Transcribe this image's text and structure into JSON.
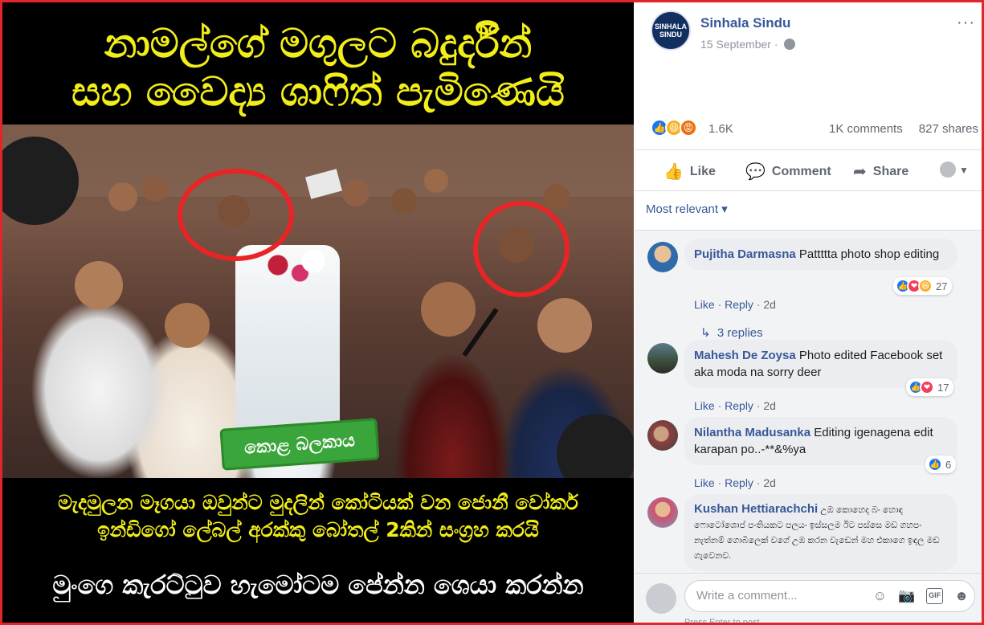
{
  "image": {
    "headline_1": "නාමල්ගේ මගුලට බදුර්දීන්",
    "headline_2": "සහ වෛද්‍ය ශාෆිත් පැමිණෙයි",
    "banner_text": "කොළ බලකාය",
    "bottom_1": "මැදමුලන මෑගයා ඔවුන්ට මුදලින් කෝටියක් වන ජොනී වෝකර්",
    "bottom_2": "ඉන්ඩිගෝ ලේබල් අරක්කු බෝතල් 2කින් සංග්‍රහ කරයි",
    "bottom_3": "මුංගෙ කැරට්ටුව හැමෝටම පේන්න ශෙයා කරන්න"
  },
  "post": {
    "page_name": "Sinhala Sindu",
    "avatar_text": "SINHALA SINDU",
    "date": "15 September · ",
    "more": "···",
    "reactions_count": "1.6K",
    "comments_count": "1K comments",
    "shares_count": "827 shares",
    "actions": {
      "like": "Like",
      "comment": "Comment",
      "share": "Share"
    },
    "sort_label": "Most relevant ▾"
  },
  "comments": [
    {
      "name": "Pujitha Darmasna",
      "text": "Pattttta photo shop editing",
      "like": "Like",
      "reply": "Reply",
      "time": "2d",
      "reactions": "27",
      "replies": "3 replies"
    },
    {
      "name": "Mahesh De Zoysa",
      "text": "Photo edited Facebook set aka moda na sorry deer",
      "like": "Like",
      "reply": "Reply",
      "time": "2d",
      "reactions": "17"
    },
    {
      "name": "Nilantha Madusanka",
      "text": "Editing igenagena edit karapan po..-**&%ya",
      "like": "Like",
      "reply": "Reply",
      "time": "2d",
      "reactions": "6"
    },
    {
      "name": "Kushan Hettiarachchi",
      "text": "උඹ කොහෙද බං හොඳ ෆොටෝශොප් පංතියකට පලයං ඉස්සලම ඊට පස්සෙ මඩ ගහපං නැත්නම් ගොබිලෙක් වගේ උඹ කරන වැඩෙන් මහ එකාගෙ ඉඳල මඩ ගැවෙනව."
    }
  ],
  "composer": {
    "placeholder": "Write a comment...",
    "hint": "Press Enter to post."
  },
  "colors": {
    "frame": "#e0262a",
    "headline": "#f2ee1a",
    "link": "#385898"
  }
}
